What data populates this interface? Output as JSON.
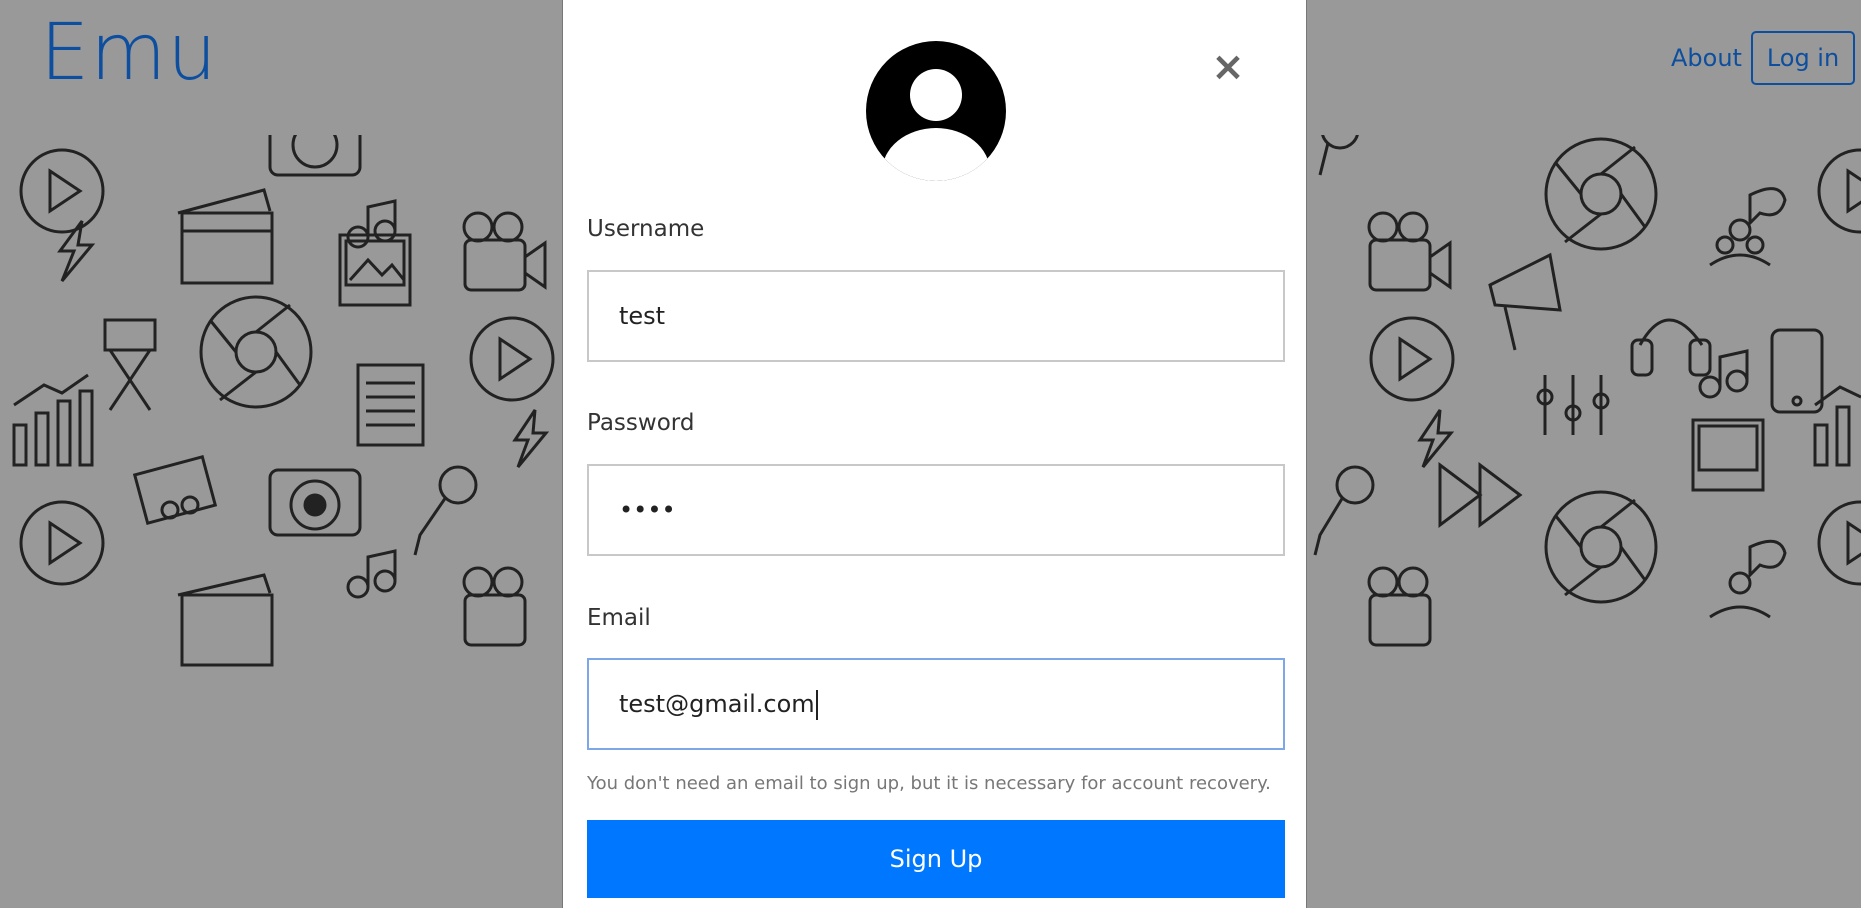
{
  "header": {
    "logo": "Emu",
    "nav": {
      "about": "About",
      "login": "Log in"
    }
  },
  "modal": {
    "close_glyph": "×",
    "avatar_icon": "user-avatar-icon",
    "username": {
      "label": "Username",
      "value": "test"
    },
    "password": {
      "label": "Password",
      "value": "••••"
    },
    "email": {
      "label": "Email",
      "value": "test@gmail.com"
    },
    "help_text": "You don't need an email to sign up, but it is necessary for account recovery.",
    "submit_label": "Sign Up"
  },
  "colors": {
    "accent": "#0077ff",
    "brand": "#0d4f9e",
    "backdrop": "#999999"
  }
}
